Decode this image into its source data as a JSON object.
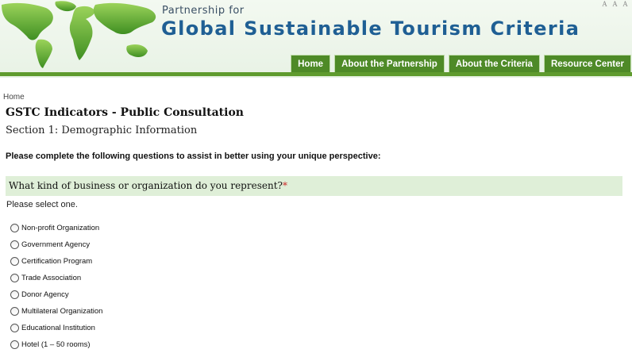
{
  "header": {
    "brand_top": "Partnership for",
    "brand_main": "Global Sustainable Tourism Criteria",
    "font_size_controls": [
      "A",
      "A",
      "A"
    ],
    "map_icon": "world-map-logo"
  },
  "nav": {
    "tabs": [
      {
        "label": "Home"
      },
      {
        "label": "About the Partnership"
      },
      {
        "label": "About the Criteria"
      },
      {
        "label": "Resource Center"
      }
    ]
  },
  "breadcrumb": "Home",
  "page_title": "GSTC Indicators - Public Consultation",
  "section_title": "Section 1: Demographic Information",
  "instructions": "Please complete the following questions to assist in better using your unique perspective:",
  "question": {
    "text": "What kind of business or organization do you represent?",
    "required_marker": "*",
    "prompt": "Please select one."
  },
  "options": [
    {
      "label": "Non-profit Organization"
    },
    {
      "label": "Government Agency"
    },
    {
      "label": "Certification Program"
    },
    {
      "label": "Trade Association"
    },
    {
      "label": "Donor Agency"
    },
    {
      "label": "Multilateral Organization"
    },
    {
      "label": "Educational Institution"
    },
    {
      "label": "Hotel (1 – 50 rooms)"
    }
  ],
  "colors": {
    "nav_green": "#4e8a27",
    "brand_blue": "#1f5f94",
    "question_bg": "#dfefd8",
    "required": "#cc2a2a"
  }
}
